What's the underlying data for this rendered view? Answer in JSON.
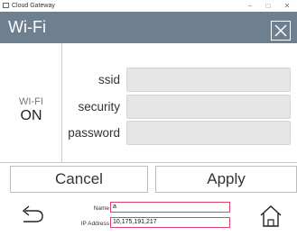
{
  "window": {
    "title": "Cloud Gateway",
    "minimize_glyph": "–",
    "maximize_glyph": "□",
    "close_glyph": "✕"
  },
  "header": {
    "title": "Wi-Fi",
    "close_icon": "close-icon"
  },
  "status": {
    "label": "WI-FI",
    "value": "ON"
  },
  "form": {
    "ssid_label": "ssid",
    "ssid_value": "",
    "security_label": "security",
    "security_value": "",
    "password_label": "password",
    "password_value": ""
  },
  "actions": {
    "cancel_label": "Cancel",
    "apply_label": "Apply"
  },
  "footer": {
    "name_label": "Name",
    "name_value": "a",
    "ip_label": "IP Address",
    "ip_value": "10,175,191,217",
    "back_icon": "back-arrow-icon",
    "home_icon": "home-icon"
  },
  "colors": {
    "header_bg": "#6e7f8f",
    "input_bg": "#e6e6e6",
    "footer_input_border": "#e0406a"
  }
}
